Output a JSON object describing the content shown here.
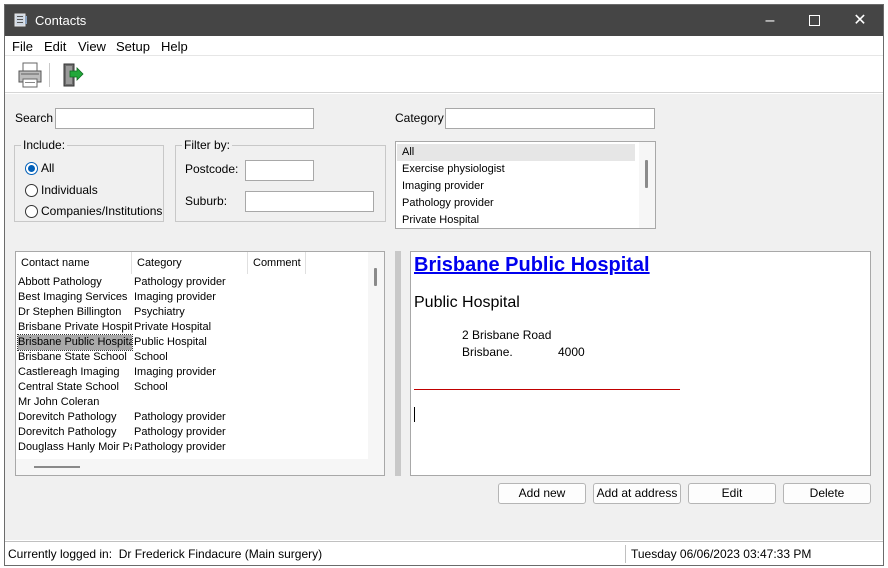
{
  "window": {
    "title": "Contacts"
  },
  "menu": [
    "File",
    "Edit",
    "View",
    "Setup",
    "Help"
  ],
  "search": {
    "label": "Search",
    "value": ""
  },
  "category_filter": {
    "label": "Category",
    "value": ""
  },
  "include": {
    "legend": "Include:",
    "options": [
      "All",
      "Individuals",
      "Companies/Institutions"
    ],
    "selected": "All"
  },
  "filter_by": {
    "legend": "Filter by:",
    "postcode_label": "Postcode:",
    "suburb_label": "Suburb:",
    "postcode_value": "",
    "suburb_value": ""
  },
  "category_list": [
    "All",
    "Exercise physiologist",
    "Imaging provider",
    "Pathology provider",
    "Private Hospital"
  ],
  "contacts_table": {
    "headers": [
      "Contact name",
      "Category",
      "Comment"
    ],
    "rows": [
      [
        "Abbott Pathology",
        "Pathology provider",
        ""
      ],
      [
        "Best Imaging Services",
        "Imaging provider",
        ""
      ],
      [
        "Dr Stephen Billington",
        "Psychiatry",
        ""
      ],
      [
        "Brisbane Private Hospital",
        "Private Hospital",
        ""
      ],
      [
        "Brisbane Public Hospital",
        "Public Hospital",
        ""
      ],
      [
        "Brisbane State School",
        "School",
        ""
      ],
      [
        "Castlereagh Imaging",
        "Imaging provider",
        ""
      ],
      [
        "Central State School",
        "School",
        ""
      ],
      [
        "Mr John Coleran",
        "",
        ""
      ],
      [
        "Dorevitch Pathology",
        "Pathology provider",
        ""
      ],
      [
        "Dorevitch Pathology",
        "Pathology provider",
        ""
      ],
      [
        "Douglass Hanly Moir Pathology",
        "Pathology provider",
        ""
      ]
    ],
    "selected_index": 4
  },
  "detail": {
    "name": "Brisbane Public Hospital",
    "category": "Public Hospital",
    "address_line": "2 Brisbane Road",
    "suburb": "Brisbane.",
    "postcode": "4000",
    "link_color": "#0000ee",
    "rule_color": "#c00000"
  },
  "buttons": {
    "add_new": "Add new",
    "add_at_address": "Add at address",
    "edit": "Edit",
    "delete": "Delete"
  },
  "status": {
    "logged_in": "Currently logged in:  Dr Frederick Findacure (Main surgery)",
    "datetime": "Tuesday 06/06/2023 03:47:33 PM"
  },
  "icons": {
    "app": "contacts-app-icon",
    "print": "printer-icon",
    "exit": "exit-door-icon"
  }
}
